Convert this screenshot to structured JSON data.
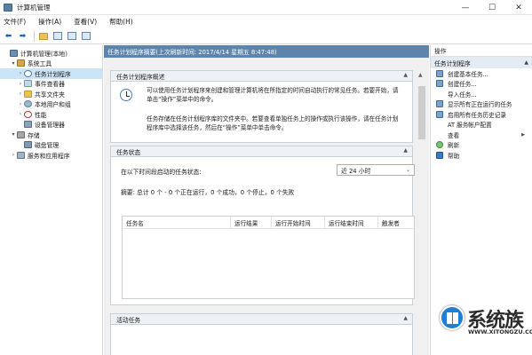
{
  "window": {
    "title": "计算机管理",
    "minimize": "—",
    "maximize": "☐",
    "close": "✕"
  },
  "menu": [
    "文件(F)",
    "操作(A)",
    "查看(V)",
    "帮助(H)"
  ],
  "tree": {
    "items": [
      {
        "label": "计算机管理(本地)",
        "indent": 0,
        "arrow": "",
        "icon": "ic-computer",
        "name": "tree-item-computer-management"
      },
      {
        "label": "系统工具",
        "indent": 1,
        "arrow": "▾",
        "icon": "ic-tools",
        "name": "tree-item-system-tools"
      },
      {
        "label": "任务计划程序",
        "indent": 2,
        "arrow": "›",
        "icon": "ic-clock",
        "name": "tree-item-task-scheduler",
        "selected": true
      },
      {
        "label": "事件查看器",
        "indent": 2,
        "arrow": "›",
        "icon": "ic-log",
        "name": "tree-item-event-viewer"
      },
      {
        "label": "共享文件夹",
        "indent": 2,
        "arrow": "›",
        "icon": "ic-folder",
        "name": "tree-item-shared-folders"
      },
      {
        "label": "本地用户和组",
        "indent": 2,
        "arrow": "›",
        "icon": "ic-users",
        "name": "tree-item-local-users"
      },
      {
        "label": "性能",
        "indent": 2,
        "arrow": "›",
        "icon": "ic-perf",
        "name": "tree-item-performance"
      },
      {
        "label": "设备管理器",
        "indent": 2,
        "arrow": "",
        "icon": "ic-device",
        "name": "tree-item-device-manager"
      },
      {
        "label": "存储",
        "indent": 1,
        "arrow": "▾",
        "icon": "ic-storage",
        "name": "tree-item-storage"
      },
      {
        "label": "磁盘管理",
        "indent": 2,
        "arrow": "",
        "icon": "ic-disk",
        "name": "tree-item-disk-management"
      },
      {
        "label": "服务和应用程序",
        "indent": 1,
        "arrow": "›",
        "icon": "ic-services",
        "name": "tree-item-services-apps"
      }
    ]
  },
  "center": {
    "header": "任务计划程序摘要(上次刷新时间: 2017/4/14 星期五 8:47:48)",
    "overview": {
      "title": "任务计划程序概述",
      "p1": "可以使用任务计划程序来创建和管理计算机将在所指定的时间自动执行的常见任务。若要开始，请单击“操作”菜单中的命令。",
      "p2": "任务存储在任务计划程序库的文件夹中。若要查看单独任务上的操作或执行该操作，请在任务计划程序库中选择该任务，然后在“操作”菜单中单击命令。"
    },
    "status": {
      "title": "任务状态",
      "filter_label": "在以下时间段启动的任务状态:",
      "filter_value": "近 24 小时",
      "summary": "摘要: 总计 0 个 - 0 个正在运行，0 个成功，0 个停止，0 个失败",
      "columns": [
        "任务名",
        "运行结果",
        "运行开始时间",
        "运行结束时间",
        "触发者"
      ]
    },
    "active": {
      "title": "活动任务"
    }
  },
  "actions": {
    "title": "操作",
    "group": "任务计划程序",
    "items": [
      {
        "label": "创建基本任务...",
        "icon": "ai-blue",
        "name": "action-create-basic-task"
      },
      {
        "label": "创建任务...",
        "icon": "ai-blue",
        "name": "action-create-task"
      },
      {
        "label": "导入任务...",
        "icon": "ai-none",
        "name": "action-import-task"
      },
      {
        "label": "显示所有正在运行的任务",
        "icon": "ai-blue",
        "name": "action-show-running-tasks"
      },
      {
        "label": "启用所有任务历史记录",
        "icon": "ai-blue",
        "name": "action-enable-history"
      },
      {
        "label": "AT 服务帐户配置",
        "icon": "ai-none",
        "name": "action-at-service-config"
      },
      {
        "label": "查看",
        "icon": "ai-none",
        "name": "action-view",
        "submenu": true
      },
      {
        "label": "刷新",
        "icon": "ai-green",
        "name": "action-refresh"
      },
      {
        "label": "帮助",
        "icon": "ai-help",
        "name": "action-help"
      }
    ]
  },
  "watermark": {
    "brand": "系统族",
    "site": "WWW.XITONGZU.COM"
  }
}
